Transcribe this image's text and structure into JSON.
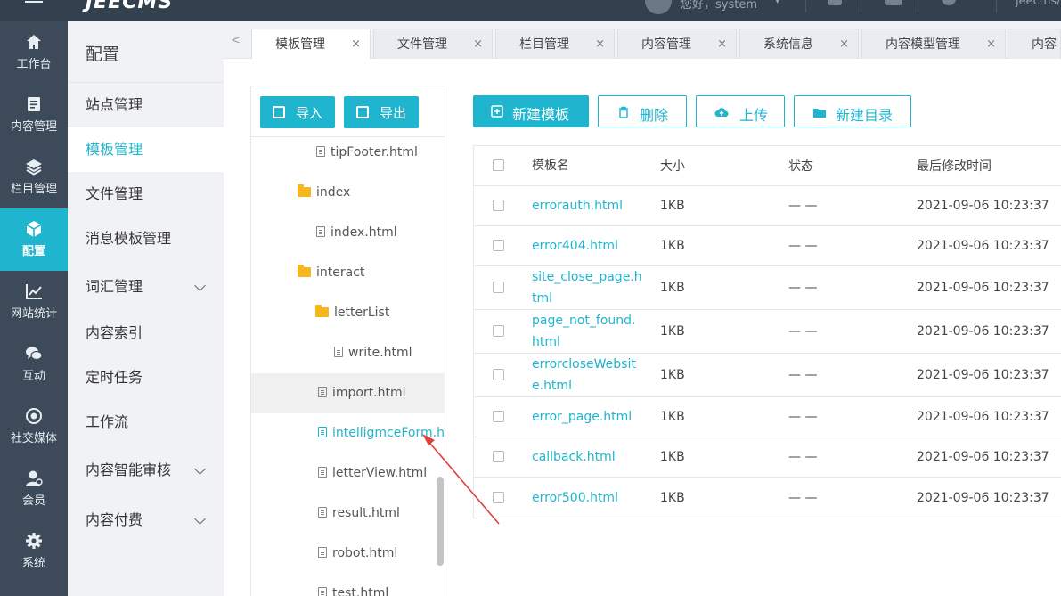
{
  "topbar": {
    "logo": "JEECMS",
    "greeting": "您好，system",
    "site": "jeecms/"
  },
  "leftnav": {
    "items": [
      {
        "label": "工作台",
        "icon": "home-icon"
      },
      {
        "label": "内容管理",
        "icon": "document-icon"
      },
      {
        "label": "栏目管理",
        "icon": "layers-icon"
      },
      {
        "label": "配置",
        "icon": "cube-icon",
        "active": true
      },
      {
        "label": "网站统计",
        "icon": "chart-icon"
      },
      {
        "label": "互动",
        "icon": "chat-icon"
      },
      {
        "label": "社交媒体",
        "icon": "target-icon"
      },
      {
        "label": "会员",
        "icon": "user-icon"
      },
      {
        "label": "系统",
        "icon": "gear-icon"
      }
    ]
  },
  "submenu": {
    "title": "配置",
    "items": [
      {
        "label": "站点管理"
      },
      {
        "label": "模板管理",
        "active": true
      },
      {
        "label": "文件管理"
      },
      {
        "label": "消息模板管理"
      },
      {
        "label": "词汇管理",
        "expandable": true
      },
      {
        "label": "内容索引"
      },
      {
        "label": "定时任务"
      },
      {
        "label": "工作流"
      },
      {
        "label": "内容智能审核",
        "expandable": true
      },
      {
        "label": "内容付费",
        "expandable": true
      }
    ]
  },
  "tabs": {
    "prev": "<",
    "close": "×",
    "items": [
      {
        "label": "模板管理",
        "active": true
      },
      {
        "label": "文件管理"
      },
      {
        "label": "栏目管理"
      },
      {
        "label": "内容管理"
      },
      {
        "label": "系统信息"
      },
      {
        "label": "内容模型管理"
      },
      {
        "label": "内容"
      }
    ]
  },
  "tree": {
    "import_label": "导入",
    "export_label": "导出",
    "nodes": [
      {
        "label": "tipFooter.html",
        "type": "file",
        "depth": 1
      },
      {
        "label": "index",
        "type": "folder",
        "depth": 0
      },
      {
        "label": "index.html",
        "type": "file",
        "depth": 1
      },
      {
        "label": "interact",
        "type": "folder",
        "depth": 0
      },
      {
        "label": "letterList",
        "type": "folder",
        "depth": 1
      },
      {
        "label": "write.html",
        "type": "file",
        "depth": 2
      },
      {
        "label": "import.html",
        "type": "file",
        "depth": 1,
        "hover": true
      },
      {
        "label": "intelligmceForm.html",
        "type": "file",
        "depth": 1,
        "selected": true
      },
      {
        "label": "letterView.html",
        "type": "file",
        "depth": 1
      },
      {
        "label": "result.html",
        "type": "file",
        "depth": 1
      },
      {
        "label": "robot.html",
        "type": "file",
        "depth": 1
      },
      {
        "label": "test.html",
        "type": "file",
        "depth": 1
      }
    ]
  },
  "actions": {
    "new_template": "新建模板",
    "delete": "删除",
    "upload": "上传",
    "new_folder": "新建目录"
  },
  "table": {
    "headers": {
      "name": "模板名",
      "size": "大小",
      "status": "状态",
      "modified": "最后修改时间"
    },
    "rows": [
      {
        "name": "errorauth.html",
        "size": "1KB",
        "status": "— —",
        "modified": "2021-09-06 10:23:37"
      },
      {
        "name": "error404.html",
        "size": "1KB",
        "status": "— —",
        "modified": "2021-09-06 10:23:37"
      },
      {
        "name": "site_close_page.html",
        "size": "1KB",
        "status": "— —",
        "modified": "2021-09-06 10:23:37"
      },
      {
        "name": "page_not_found.html",
        "size": "1KB",
        "status": "— —",
        "modified": "2021-09-06 10:23:37"
      },
      {
        "name": "errorcloseWebsite.html",
        "size": "1KB",
        "status": "— —",
        "modified": "2021-09-06 10:23:37"
      },
      {
        "name": "error_page.html",
        "size": "1KB",
        "status": "— —",
        "modified": "2021-09-06 10:23:37"
      },
      {
        "name": "callback.html",
        "size": "1KB",
        "status": "— —",
        "modified": "2021-09-06 10:23:37"
      },
      {
        "name": "error500.html",
        "size": "1KB",
        "status": "— —",
        "modified": "2021-09-06 10:23:37"
      }
    ]
  },
  "colors": {
    "accent": "#1fb5ce",
    "nav_bg": "#3c4a59",
    "topbar_bg": "#33404e",
    "annotation": "#e0403a"
  }
}
